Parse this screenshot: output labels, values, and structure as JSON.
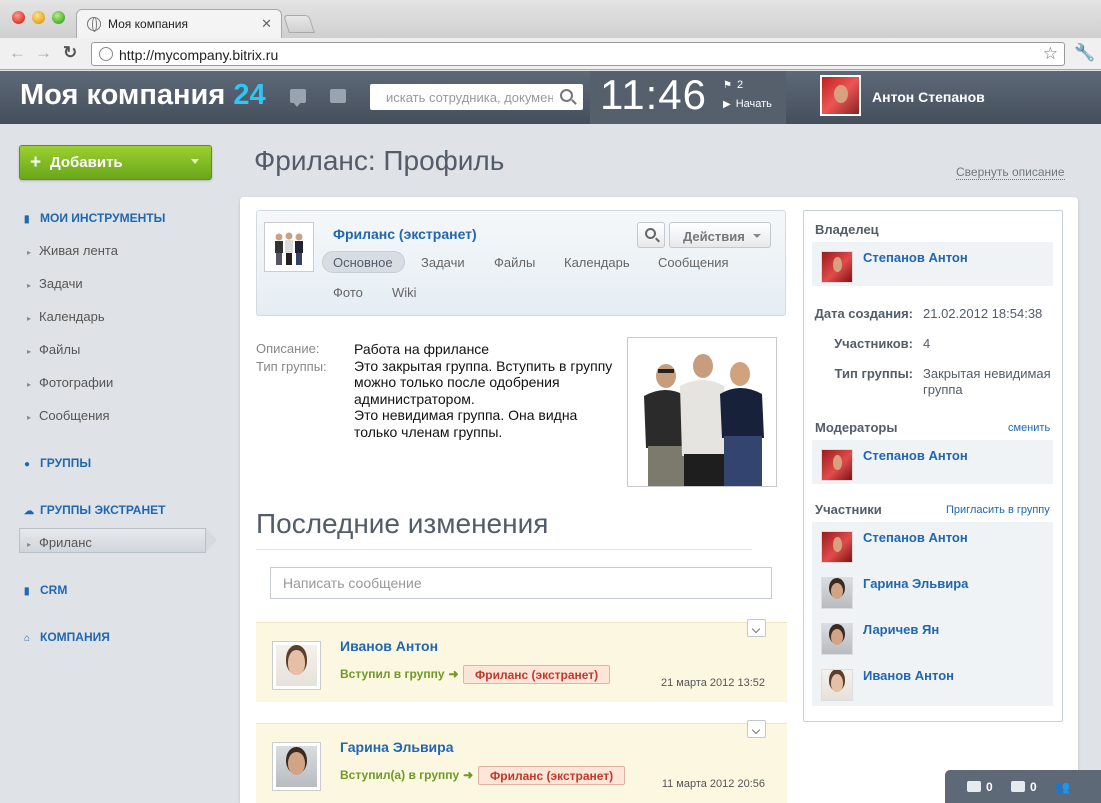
{
  "browser": {
    "tab_title": "Моя компания",
    "url": "http://mycompany.bitrix.ru"
  },
  "header": {
    "logo_text": "Моя компания",
    "logo_number": "24",
    "search_placeholder": "искать сотрудника, документ",
    "clock": "11:46",
    "tasks_count": "2",
    "start_label": "Начать",
    "user_name": "Антон Степанов"
  },
  "sidebar": {
    "add_label": "Добавить",
    "section_tools": "Мои инструменты",
    "tools": [
      "Живая лента",
      "Задачи",
      "Календарь",
      "Файлы",
      "Фотографии",
      "Сообщения"
    ],
    "section_groups": "Группы",
    "section_extranet": "Группы экстранет",
    "extranet_active": "Фриланс",
    "section_crm": "CRM",
    "section_company": "Компания"
  },
  "page": {
    "title": "Фриланс: Профиль",
    "collapse_link": "Свернуть описание"
  },
  "group": {
    "name": "Фриланс (экстранет)",
    "actions_label": "Действия",
    "tabs": [
      "Основное",
      "Задачи",
      "Файлы",
      "Календарь",
      "Сообщения",
      "Фото",
      "Wiki"
    ],
    "desc_label": "Описание:",
    "type_label": "Тип группы:",
    "desc_line1": "Работа на фрилансе",
    "desc_line2": "Это закрытая группа. Вступить в группу можно только после одобрения администратором.",
    "desc_line3": "Это невидимая группа. Она видна только членам группы."
  },
  "changes": {
    "title": "Последние изменения",
    "input_placeholder": "Написать сообщение",
    "items": [
      {
        "name": "Иванов Антон",
        "action": "Вступил в группу",
        "tag": "Фриланс (экстранет)",
        "date": "21 марта 2012 13:52"
      },
      {
        "name": "Гарина Эльвира",
        "action": "Вступил(а) в группу",
        "tag": "Фриланс (экстранет)",
        "date": "11 марта 2012 20:56"
      }
    ]
  },
  "info": {
    "owner_label": "Владелец",
    "owner_name": "Степанов Антон",
    "created_label": "Дата создания:",
    "created_value": "21.02.2012 18:54:38",
    "members_count_label": "Участников:",
    "members_count_value": "4",
    "group_type_label": "Тип группы:",
    "group_type_value": "Закрытая невидимая группа",
    "moderators_label": "Модераторы",
    "moderators_link": "сменить",
    "moderator_name": "Степанов Антон",
    "members_label": "Участники",
    "members_link": "Пригласить в группу",
    "members": [
      "Степанов Антон",
      "Гарина Эльвира",
      "Ларичев Ян",
      "Иванов Антон"
    ]
  },
  "bottom_bar": {
    "messages_count": "0",
    "notifications_count": "0"
  },
  "colors": {
    "accent_blue": "#2067b0",
    "add_green": "#7bb521",
    "header_bg": "#535c69",
    "logo_number": "#2fc6f6"
  }
}
